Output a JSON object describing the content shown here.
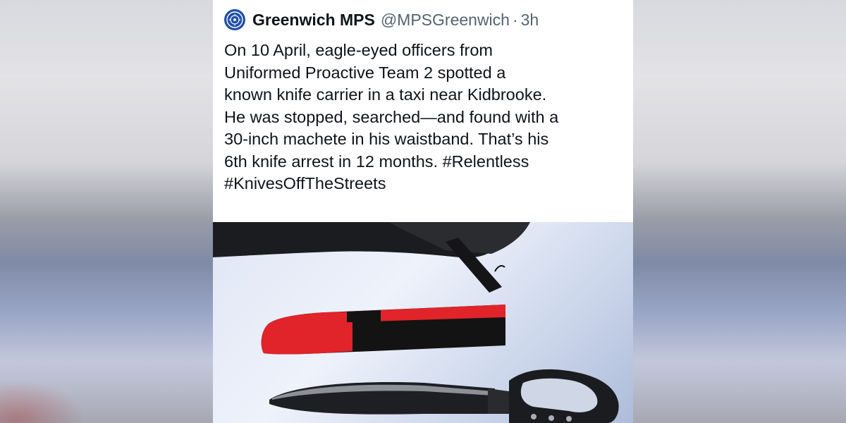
{
  "tweet": {
    "display_name": "Greenwich MPS",
    "handle": "@MPSGreenwich",
    "separator": "·",
    "time": "3h",
    "lines": [
      "On 10 April, eagle-eyed officers from",
      "Uniformed Proactive Team 2 spotted a",
      "known knife carrier in a taxi near Kidbrooke.",
      "He was stopped, searched—and found with a",
      "30-inch machete in his waistband. That’s his",
      "6th knife arrest in 12 months. #Relentless",
      "#KnivesOffTheStreets"
    ],
    "avatar_icon": "police-crest-icon",
    "avatar_color": "#1f4fa8"
  },
  "photo": {
    "subject_icons": [
      "sheath-icon",
      "machete-icon",
      "strap-icon"
    ],
    "colors": {
      "tape_red": "#e0242a",
      "sheath_black": "#121212",
      "background": "#e6ecf7"
    }
  }
}
